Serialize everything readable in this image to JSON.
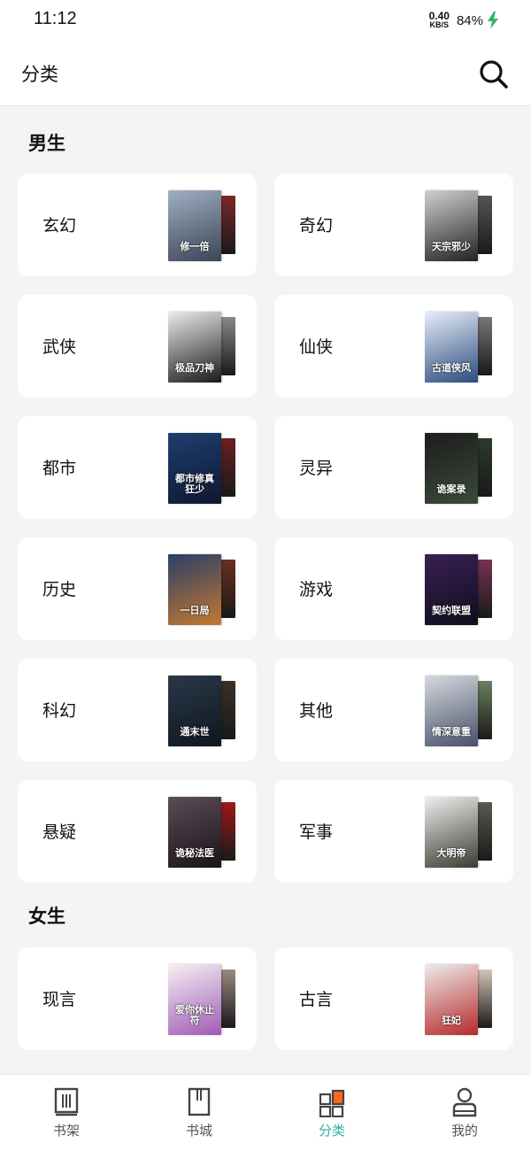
{
  "status_bar": {
    "time": "11:12",
    "net_speed_value": "0.40",
    "net_speed_unit": "KB/S",
    "battery": "84%"
  },
  "header": {
    "title": "分类"
  },
  "sections": [
    {
      "title": "男生",
      "categories": [
        {
          "label": "玄幻",
          "cover_title": "修一倍",
          "colors": [
            "#9fb0c2",
            "#3a4456",
            "#7a2828"
          ]
        },
        {
          "label": "奇幻",
          "cover_title": "天宗邪少",
          "colors": [
            "#cfd1cf",
            "#222222",
            "#555555"
          ]
        },
        {
          "label": "武侠",
          "cover_title": "极品刀神",
          "colors": [
            "#ececec",
            "#1a1a1a",
            "#888888"
          ]
        },
        {
          "label": "仙侠",
          "cover_title": "古道侠风",
          "colors": [
            "#e6eef8",
            "#2c4c80",
            "#777777"
          ]
        },
        {
          "label": "都市",
          "cover_title": "都市修真狂少",
          "colors": [
            "#1e3e6e",
            "#0f1830",
            "#6a2020"
          ]
        },
        {
          "label": "灵异",
          "cover_title": "诡案录",
          "colors": [
            "#1c1c1c",
            "#3c4a3c",
            "#2b3a2b"
          ]
        },
        {
          "label": "历史",
          "cover_title": "一日局",
          "colors": [
            "#2a3e68",
            "#c47830",
            "#6a3020"
          ]
        },
        {
          "label": "游戏",
          "cover_title": "契约联盟",
          "colors": [
            "#3a1f55",
            "#0f0f1c",
            "#773355"
          ]
        },
        {
          "label": "科幻",
          "cover_title": "通末世",
          "colors": [
            "#2a3848",
            "#0f1620",
            "#3c3028"
          ]
        },
        {
          "label": "其他",
          "cover_title": "情深意重",
          "colors": [
            "#d6d9de",
            "#48506a",
            "#6a8060"
          ]
        },
        {
          "label": "悬疑",
          "cover_title": "诡秘法医",
          "colors": [
            "#5a4c56",
            "#1a1418",
            "#a01818"
          ]
        },
        {
          "label": "军事",
          "cover_title": "大明帝",
          "colors": [
            "#eeeeee",
            "#3c3c32",
            "#5a5a50"
          ]
        }
      ]
    },
    {
      "title": "女生",
      "categories": [
        {
          "label": "现言",
          "cover_title": "爱你休止符",
          "colors": [
            "#f6f0f3",
            "#a05ab4",
            "#9a8a80"
          ]
        },
        {
          "label": "古言",
          "cover_title": "狂妃",
          "colors": [
            "#ececec",
            "#b82828",
            "#d4c4b4"
          ]
        }
      ]
    }
  ],
  "bottom_nav": [
    {
      "label": "书架",
      "icon": "bookshelf-icon",
      "active": false
    },
    {
      "label": "书城",
      "icon": "bookstore-icon",
      "active": false
    },
    {
      "label": "分类",
      "icon": "category-icon",
      "active": true
    },
    {
      "label": "我的",
      "icon": "profile-icon",
      "active": false
    }
  ],
  "colors": {
    "accent": "#2ab2a7",
    "category_badge": "#ff6a1a",
    "background": "#f4f4f4",
    "card": "#ffffff"
  }
}
